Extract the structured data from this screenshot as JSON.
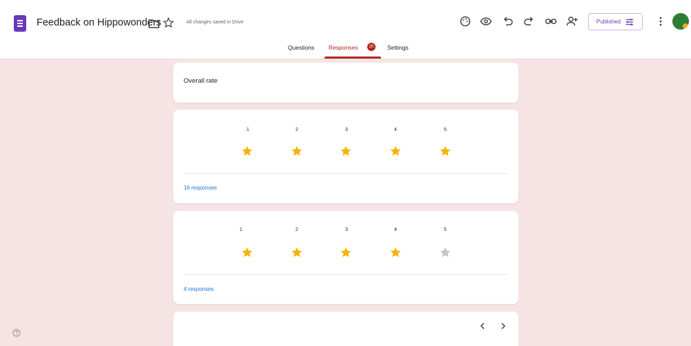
{
  "header": {
    "doc_title": "Feedback on Hippowonders",
    "save_status": "All changes saved in Drive",
    "published_label": "Published",
    "icons": [
      "palette-icon",
      "preview-eye-icon",
      "undo-icon",
      "redo-icon",
      "link-icon",
      "add-collaborator-icon",
      "customize-icon",
      "more-vert-icon"
    ]
  },
  "tabs": {
    "questions": "Questions",
    "responses": "Responses",
    "responses_badge": "20",
    "settings": "Settings"
  },
  "colors": {
    "accent": "#673ab7",
    "tab_active": "#b3261e",
    "star_filled": "#f4b400",
    "star_empty": "#c4c4c4",
    "link": "#1a73e8",
    "background": "#f6e4e4"
  },
  "main": {
    "question_title": "Overall rate",
    "scale_labels": [
      "1",
      "2",
      "3",
      "4",
      "5"
    ],
    "responses": [
      {
        "rating": 5,
        "count_label": "16 responses"
      },
      {
        "rating": 4,
        "count_label": "4 responses"
      }
    ]
  }
}
